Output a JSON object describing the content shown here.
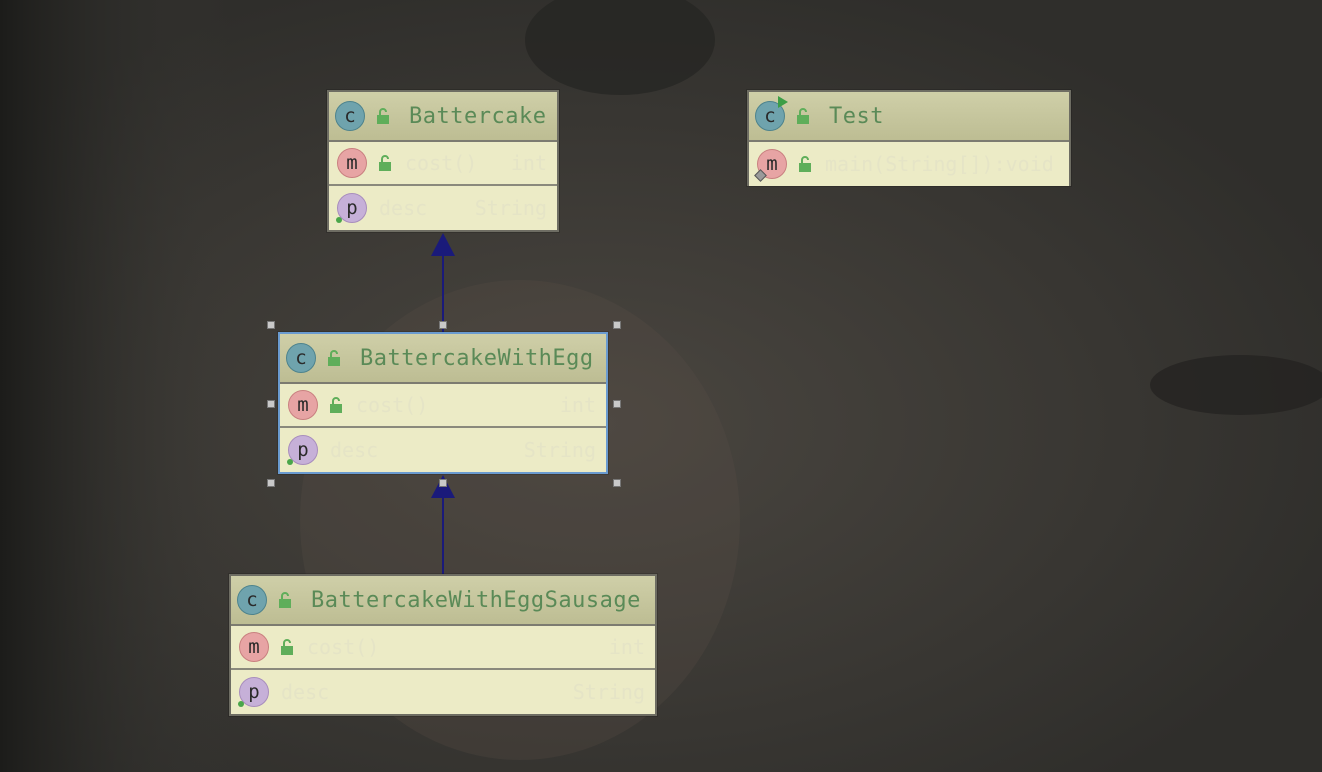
{
  "diagram": {
    "classes": [
      {
        "id": "battercake",
        "name": "Battercake",
        "members": [
          {
            "kind": "method",
            "icon": "method-icon",
            "name": "cost()",
            "type": "int"
          },
          {
            "kind": "prop",
            "icon": "property-icon",
            "name": "desc",
            "type": "String"
          }
        ]
      },
      {
        "id": "test",
        "name": "Test",
        "runnable": true,
        "members": [
          {
            "kind": "method",
            "icon": "method-icon",
            "name": "main(String[]):void",
            "type": ""
          }
        ]
      },
      {
        "id": "battercake-with-egg",
        "name": "BattercakeWithEgg",
        "selected": true,
        "members": [
          {
            "kind": "method",
            "icon": "method-icon",
            "name": "cost()",
            "type": "int"
          },
          {
            "kind": "prop",
            "icon": "property-icon",
            "name": "desc",
            "type": "String"
          }
        ]
      },
      {
        "id": "battercake-with-egg-sausage",
        "name": "BattercakeWithEggSausage",
        "members": [
          {
            "kind": "method",
            "icon": "method-icon",
            "name": "cost()",
            "type": "int"
          },
          {
            "kind": "prop",
            "icon": "property-icon",
            "name": "desc",
            "type": "String"
          }
        ]
      }
    ],
    "edges": [
      {
        "from": "battercake-with-egg",
        "to": "battercake",
        "kind": "extends"
      },
      {
        "from": "battercake-with-egg-sausage",
        "to": "battercake-with-egg",
        "kind": "extends"
      }
    ],
    "colors": {
      "arrow": "#1a1a7a",
      "class_name": "#5a8a57",
      "selection": "#6a9bd0"
    },
    "icons": {
      "class": "class-icon",
      "lock": "public-lock-icon"
    },
    "labels": {
      "class_badge": "c",
      "method_badge": "m",
      "prop_badge": "p"
    }
  }
}
